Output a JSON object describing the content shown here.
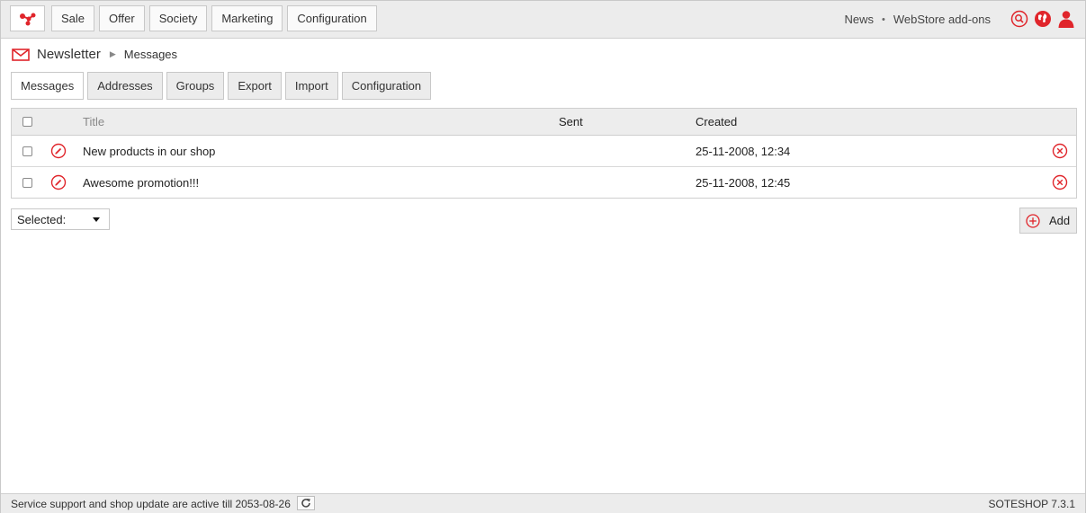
{
  "colors": {
    "accent": "#e0252b",
    "bar_bg": "#ececec",
    "border": "#c8c8c8"
  },
  "topbar": {
    "logo_icon": "share-nodes-icon",
    "nav": [
      {
        "label": "Sale"
      },
      {
        "label": "Offer"
      },
      {
        "label": "Society"
      },
      {
        "label": "Marketing"
      },
      {
        "label": "Configuration"
      }
    ],
    "links": {
      "news": "News",
      "separator": "•",
      "addons": "WebStore add-ons"
    },
    "icons": [
      "search-icon",
      "globe-icon",
      "user-icon"
    ]
  },
  "breadcrumb": {
    "icon": "envelope-icon",
    "title": "Newsletter",
    "separator": "▶",
    "current": "Messages"
  },
  "subtabs": [
    {
      "label": "Messages",
      "active": true
    },
    {
      "label": "Addresses",
      "active": false
    },
    {
      "label": "Groups",
      "active": false
    },
    {
      "label": "Export",
      "active": false
    },
    {
      "label": "Import",
      "active": false
    },
    {
      "label": "Configuration",
      "active": false
    }
  ],
  "table": {
    "columns": {
      "title": "Title",
      "sent": "Sent",
      "created": "Created"
    },
    "rows": [
      {
        "title": "New products in our shop",
        "sent": "",
        "created": "25-11-2008, 12:34"
      },
      {
        "title": "Awesome promotion!!!",
        "sent": "",
        "created": "25-11-2008, 12:45"
      }
    ]
  },
  "controls": {
    "selected_label": "Selected:",
    "add_label": "Add"
  },
  "status": {
    "text": "Service support and shop update are active till 2053-08-26",
    "version": "SOTESHOP 7.3.1"
  }
}
